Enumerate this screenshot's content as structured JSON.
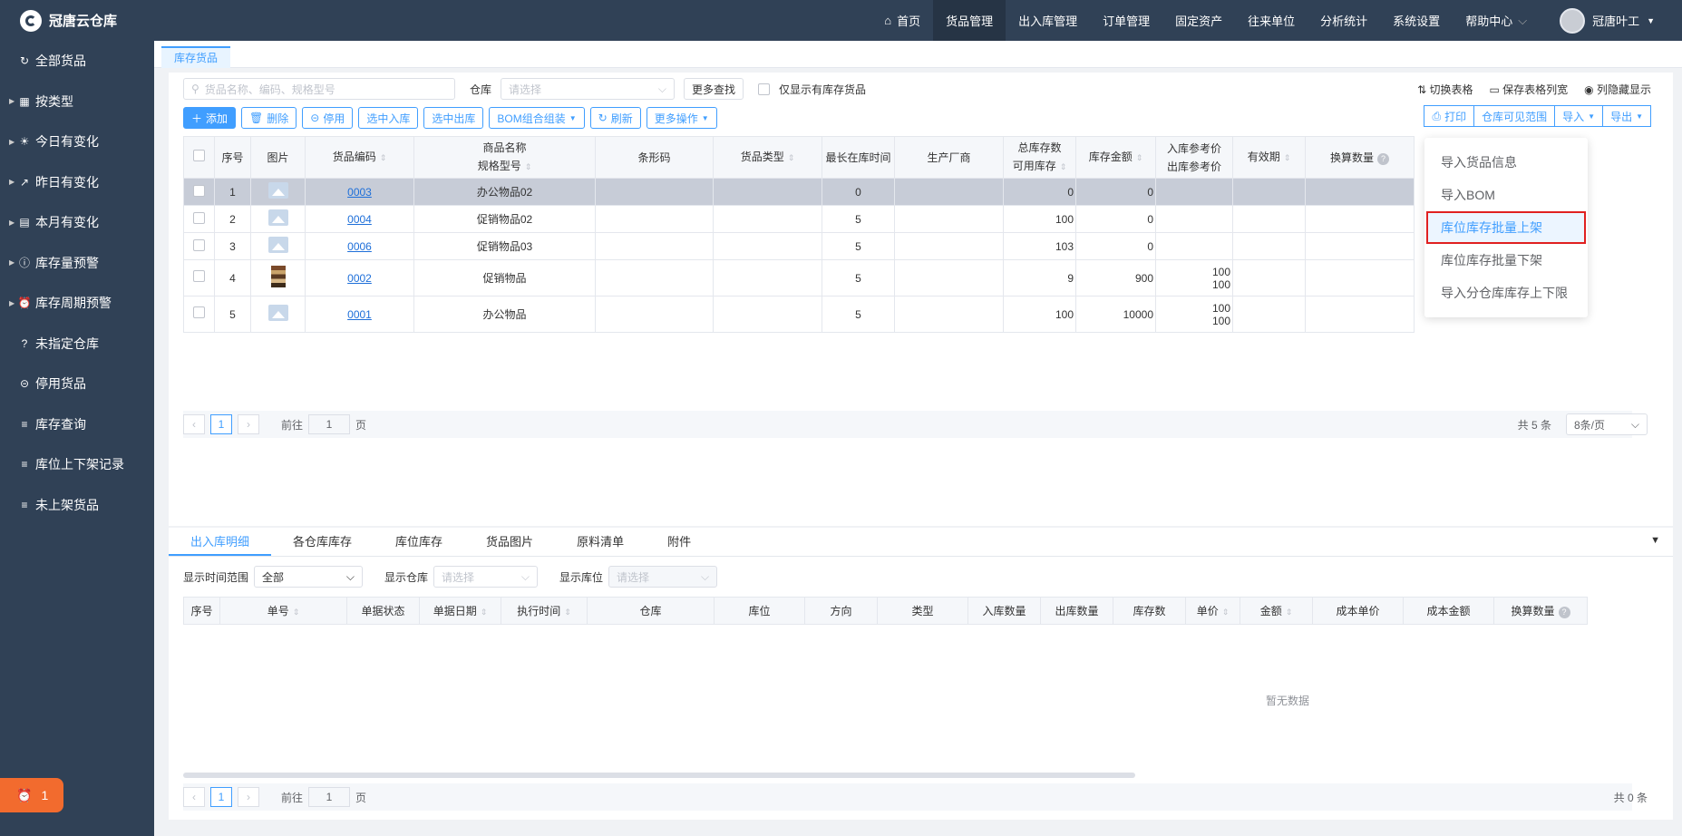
{
  "app": {
    "title": "冠唐云仓库"
  },
  "sidebar": {
    "items": [
      {
        "label": "全部货品",
        "icon": "refresh-icon",
        "arrow": false
      },
      {
        "label": "按类型",
        "icon": "grid-icon",
        "arrow": true
      },
      {
        "label": "今日有变化",
        "icon": "sun-icon",
        "arrow": true
      },
      {
        "label": "昨日有变化",
        "icon": "trend-icon",
        "arrow": true
      },
      {
        "label": "本月有变化",
        "icon": "calendar-icon",
        "arrow": true
      },
      {
        "label": "库存量预警",
        "icon": "alert-icon",
        "arrow": true
      },
      {
        "label": "库存周期预警",
        "icon": "alarm-icon",
        "arrow": true
      },
      {
        "label": "未指定仓库",
        "icon": "question-icon",
        "arrow": false
      },
      {
        "label": "停用货品",
        "icon": "minus-circle-icon",
        "arrow": false
      },
      {
        "label": "库存查询",
        "icon": "list-icon",
        "arrow": false
      },
      {
        "label": "库位上下架记录",
        "icon": "list-icon",
        "arrow": false
      },
      {
        "label": "未上架货品",
        "icon": "list-icon",
        "arrow": false
      }
    ],
    "badge": "1"
  },
  "topnav": {
    "items": [
      "首页",
      "货品管理",
      "出入库管理",
      "订单管理",
      "固定资产",
      "往来单位",
      "分析统计",
      "系统设置",
      "帮助中心"
    ],
    "active": 1,
    "user": "冠唐叶工"
  },
  "page_tab": "库存货品",
  "toolbar": {
    "search_placeholder": "货品名称、编码、规格型号",
    "warehouse_label": "仓库",
    "warehouse_placeholder": "请选择",
    "more_search": "更多查找",
    "only_stock": "仅显示有库存货品",
    "buttons": [
      "添加",
      "删除",
      "停用",
      "选中入库",
      "选中出库",
      "BOM组合组装",
      "刷新",
      "更多操作"
    ],
    "links": [
      "切换表格",
      "保存表格列宽",
      "列隐藏显示"
    ],
    "right_buttons": [
      "打印",
      "仓库可见范围",
      "导入",
      "导出"
    ]
  },
  "grid": {
    "columns": [
      "序号",
      "图片",
      "货品编码",
      "商品名称",
      "规格型号",
      "条形码",
      "货品类型",
      "最长在库时间",
      "生产厂商",
      "总库存数",
      "可用库存",
      "库存金额",
      "入库参考价",
      "出库参考价",
      "有效期",
      "换算数量"
    ],
    "rows": [
      {
        "no": "1",
        "img": "placeholder",
        "code": "0003",
        "name": "办公物品02",
        "days": "0",
        "stock": "0",
        "amount": "0",
        "in_price": "",
        "out_price": "",
        "selected": true
      },
      {
        "no": "2",
        "img": "placeholder",
        "code": "0004",
        "name": "促销物品02",
        "days": "5",
        "stock": "100",
        "amount": "0",
        "in_price": "",
        "out_price": "",
        "selected": false
      },
      {
        "no": "3",
        "img": "placeholder",
        "code": "0006",
        "name": "促销物品03",
        "days": "5",
        "stock": "103",
        "amount": "0",
        "in_price": "",
        "out_price": "",
        "selected": false
      },
      {
        "no": "4",
        "img": "books",
        "code": "0002",
        "name": "促销物品",
        "days": "5",
        "stock": "9",
        "amount": "900",
        "in_price": "100",
        "out_price": "100",
        "selected": false
      },
      {
        "no": "5",
        "img": "placeholder",
        "code": "0001",
        "name": "办公物品",
        "days": "5",
        "stock": "100",
        "amount": "10000",
        "in_price": "100",
        "out_price": "100",
        "selected": false
      }
    ]
  },
  "pager": {
    "page": "1",
    "goto_prefix": "前往",
    "goto_value": "1",
    "goto_suffix": "页",
    "total": "共 5 条",
    "page_size": "8条/页"
  },
  "import_menu": {
    "items": [
      "导入货品信息",
      "导入BOM",
      "库位库存批量上架",
      "库位库存批量下架",
      "导入分仓库库存上下限"
    ],
    "highlighted": 2
  },
  "bottom": {
    "tabs": [
      "出入库明细",
      "各仓库库存",
      "库位库存",
      "货品图片",
      "原料清单",
      "附件"
    ],
    "filters": {
      "time_label": "显示时间范围",
      "time_value": "全部",
      "wh_label": "显示仓库",
      "wh_placeholder": "请选择",
      "loc_label": "显示库位",
      "loc_placeholder": "请选择"
    },
    "columns": [
      "序号",
      "单号",
      "单据状态",
      "单据日期",
      "执行时间",
      "仓库",
      "库位",
      "方向",
      "类型",
      "入库数量",
      "出库数量",
      "库存数",
      "单价",
      "金额",
      "成本单价",
      "成本金额",
      "换算数量"
    ],
    "empty": "暂无数据",
    "pager": {
      "page": "1",
      "goto_prefix": "前往",
      "goto_value": "1",
      "goto_suffix": "页",
      "total": "共 0 条"
    }
  }
}
